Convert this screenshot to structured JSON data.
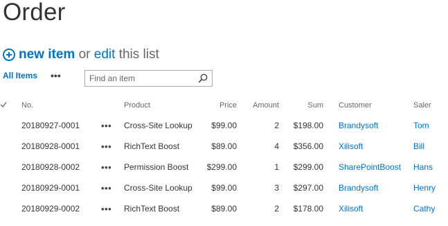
{
  "page": {
    "title": "Order"
  },
  "command_bar": {
    "new_item_label": "new item",
    "or_text": "or",
    "edit_label": "edit",
    "this_list_text": "this list"
  },
  "view": {
    "tab_label": "All Items",
    "more_label": "•••"
  },
  "search": {
    "placeholder": "Find an item"
  },
  "table": {
    "headers": {
      "no": "No.",
      "product": "Product",
      "price": "Price",
      "amount": "Amount",
      "sum": "Sum",
      "customer": "Customer",
      "saler": "Saler"
    },
    "menu_glyph": "•••",
    "rows": [
      {
        "no": "20180927-0001",
        "product": "Cross-Site Lookup",
        "price": "$99.00",
        "amount": "2",
        "sum": "$198.00",
        "customer": "Brandysoft",
        "saler": "Tom"
      },
      {
        "no": "20180928-0001",
        "product": "RichText Boost",
        "price": "$89.00",
        "amount": "4",
        "sum": "$356.00",
        "customer": "Xilisoft",
        "saler": "Bill"
      },
      {
        "no": "20180928-0002",
        "product": "Permission Boost",
        "price": "$299.00",
        "amount": "1",
        "sum": "$299.00",
        "customer": "SharePointBoost",
        "saler": "Hans"
      },
      {
        "no": "20180929-0001",
        "product": "Cross-Site Lookup",
        "price": "$99.00",
        "amount": "3",
        "sum": "$297.00",
        "customer": "Brandysoft",
        "saler": "Henry"
      },
      {
        "no": "20180929-0002",
        "product": "RichText Boost",
        "price": "$89.00",
        "amount": "2",
        "sum": "$178.00",
        "customer": "Xilisoft",
        "saler": "Cathy"
      }
    ]
  },
  "colors": {
    "link": "#0072c6",
    "text": "#333333",
    "muted": "#666666"
  }
}
